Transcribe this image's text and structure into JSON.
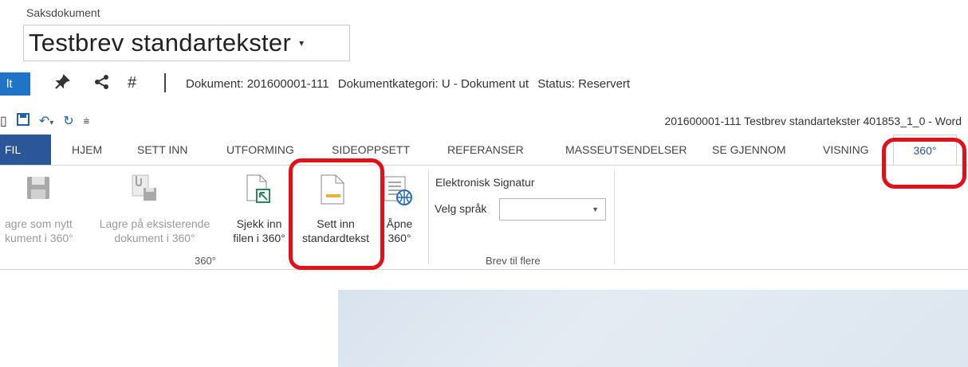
{
  "header": {
    "case_label": "Saksdokument",
    "doc_title": "Testbrev standartekster",
    "edit_tab": "lt",
    "doc_info": {
      "document": "Dokument: 201600001-111",
      "category": "Dokumentkategori: U - Dokument ut",
      "status": "Status: Reservert"
    }
  },
  "word": {
    "title": "201600001-111 Testbrev standartekster 401853_1_0 - Word"
  },
  "tabs": [
    {
      "label": "FIL"
    },
    {
      "label": "HJEM"
    },
    {
      "label": "SETT INN"
    },
    {
      "label": "UTFORMING"
    },
    {
      "label": "SIDEOPPSETT"
    },
    {
      "label": "REFERANSER"
    },
    {
      "label": "MASSEUTSENDELSER"
    },
    {
      "label": "SE GJENNOM"
    },
    {
      "label": "VISNING"
    },
    {
      "label": "360°"
    }
  ],
  "ribbon": {
    "buttons": {
      "save_new_l1": "agre som nytt",
      "save_new_l2": "kument i 360°",
      "save_existing_l1": "Lagre på eksisterende",
      "save_existing_l2": "dokument i 360°",
      "checkin_l1": "Sjekk inn",
      "checkin_l2": "filen i 360°",
      "insert_std_l1": "Sett inn",
      "insert_std_l2": "standardtekst",
      "open_l1": "Åpne",
      "open_l2": "360°"
    },
    "group_360_label": "360°",
    "signature_label": "Elektronisk Signatur",
    "language_label": "Velg språk",
    "language_value": "",
    "group_letters_label": "Brev til flere"
  },
  "colors": {
    "accent": "#2b579a",
    "edit_tab": "#1f74c8",
    "highlight": "#e0111b"
  }
}
